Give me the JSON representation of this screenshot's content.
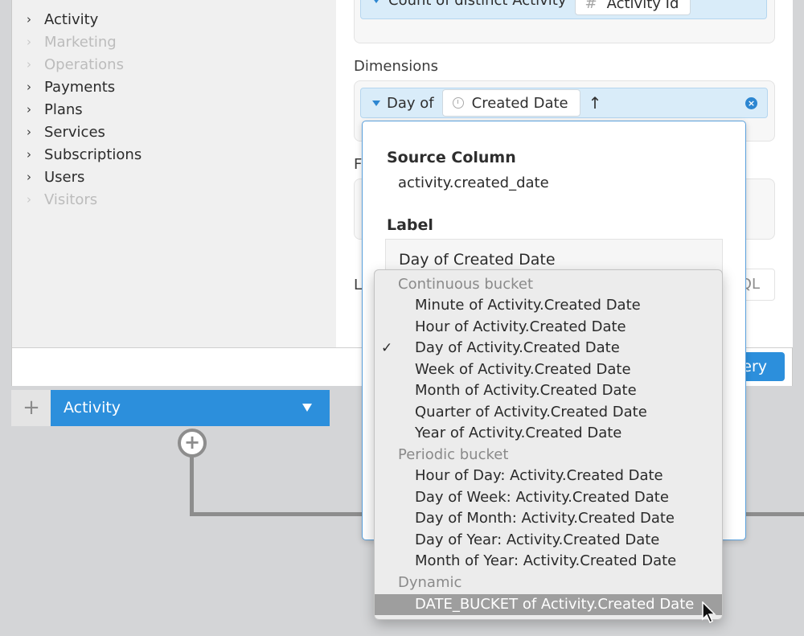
{
  "sidebar": {
    "items": [
      {
        "label": "Activity",
        "enabled": true
      },
      {
        "label": "Marketing",
        "enabled": false
      },
      {
        "label": "Operations",
        "enabled": false
      },
      {
        "label": "Payments",
        "enabled": true
      },
      {
        "label": "Plans",
        "enabled": true
      },
      {
        "label": "Services",
        "enabled": true
      },
      {
        "label": "Subscriptions",
        "enabled": true
      },
      {
        "label": "Users",
        "enabled": true
      },
      {
        "label": "Visitors",
        "enabled": false
      }
    ]
  },
  "metric": {
    "aggregation": "Count of distinct Activity",
    "field": "Activity Id",
    "field_icon": "#"
  },
  "dimensions": {
    "label": "Dimensions",
    "bucket_prefix": "Day of",
    "field": "Created Date",
    "sort_glyph": "↑"
  },
  "partial_labels": {
    "filters": "F",
    "limit": "L",
    "sql_tail": "QL"
  },
  "run_button": {
    "label": "ery"
  },
  "popover": {
    "source_column_heading": "Source Column",
    "source_column_value": "activity.created_date",
    "label_heading": "Label",
    "label_value": "Day of Created Date"
  },
  "menu": {
    "groups": [
      {
        "title": "Continuous bucket",
        "items": [
          {
            "label": "Minute of Activity.Created Date"
          },
          {
            "label": "Hour of Activity.Created Date"
          },
          {
            "label": "Day of Activity.Created Date",
            "checked": true
          },
          {
            "label": "Week of Activity.Created Date"
          },
          {
            "label": "Month of Activity.Created Date"
          },
          {
            "label": "Quarter of Activity.Created Date"
          },
          {
            "label": "Year of Activity.Created Date"
          }
        ]
      },
      {
        "title": "Periodic bucket",
        "items": [
          {
            "label": "Hour of Day: Activity.Created Date"
          },
          {
            "label": "Day of Week: Activity.Created Date"
          },
          {
            "label": "Day of Month: Activity.Created Date"
          },
          {
            "label": "Day of Year: Activity.Created Date"
          },
          {
            "label": "Month of Year: Activity.Created Date"
          }
        ]
      },
      {
        "title": "Dynamic",
        "items": [
          {
            "label": "DATE_BUCKET of Activity.Created Date",
            "highlighted": true
          }
        ]
      }
    ],
    "check_glyph": "✓"
  },
  "canvas": {
    "tab_label": "Activity",
    "plus_label": "+",
    "add_node_label": "+"
  }
}
